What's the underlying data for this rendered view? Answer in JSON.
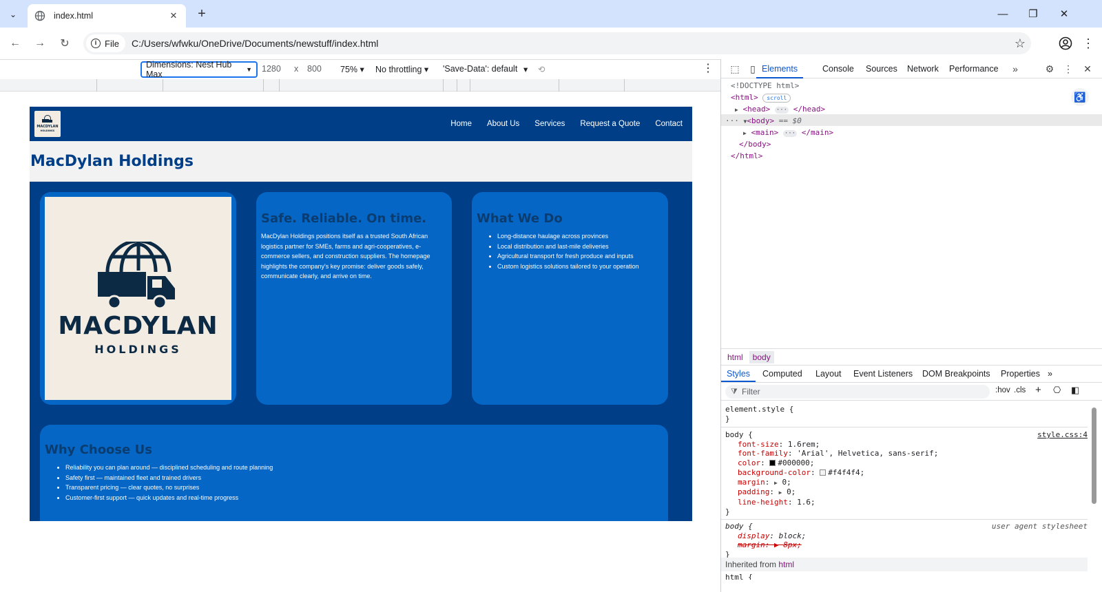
{
  "browser": {
    "tab_title": "index.html",
    "url_chip": "File",
    "url": "C:/Users/wfwku/OneDrive/Documents/newstuff/index.html"
  },
  "device_toolbar": {
    "dimensions_label": "Dimensions: Nest Hub Max",
    "width": "1280",
    "times": "x",
    "height": "800",
    "zoom": "75%",
    "throttling": "No throttling",
    "save_data": "'Save-Data': default"
  },
  "site": {
    "nav": [
      "Home",
      "About Us",
      "Services",
      "Request a Quote",
      "Contact"
    ],
    "logo_small_line1": "MACDYLAN",
    "logo_small_line2": "HOLDINGS",
    "heading": "MacDylan Holdings",
    "logo_main": "MACDYLAN",
    "logo_sub": "HOLDINGS",
    "card_safe_title": "Safe. Reliable. On time.",
    "card_safe_text": "MacDylan Holdings positions itself as a trusted South African logistics partner for SMEs, farms and agri-cooperatives, e-commerce sellers, and construction suppliers. The homepage highlights the company's key promise: deliver goods safely, communicate clearly, and arrive on time.",
    "card_what_title": "What We Do",
    "card_what_items": [
      "Long-distance haulage across provinces",
      "Local distribution and last-mile deliveries",
      "Agricultural transport for fresh produce and inputs",
      "Custom logistics solutions tailored to your operation"
    ],
    "card_why_title": "Why Choose Us",
    "card_why_items": [
      "Reliability you can plan around — disciplined scheduling and route planning",
      "Safety first — maintained fleet and trained drivers",
      "Transparent pricing — clear quotes, no surprises",
      "Customer-first support — quick updates and real-time progress"
    ]
  },
  "devtools": {
    "tabs": [
      "Elements",
      "Console",
      "Sources",
      "Network",
      "Performance"
    ],
    "dom": {
      "doctype": "<!DOCTYPE html>",
      "html_open": "<html>",
      "scroll_pill": "scroll",
      "head": "<head>",
      "head_close": "</head>",
      "body_open": "<body>",
      "body_marker": "== $0",
      "main_open": "<main>",
      "main_close": "</main>",
      "body_close": "</body>",
      "html_close": "</html>"
    },
    "breadcrumbs": [
      "html",
      "body"
    ],
    "subtabs": [
      "Styles",
      "Computed",
      "Layout",
      "Event Listeners",
      "DOM Breakpoints",
      "Properties"
    ],
    "filter_placeholder": "Filter",
    "hov": ":hov",
    "cls": ".cls",
    "styles": {
      "element_style": "element.style {",
      "close_brace": "}",
      "body_selector": "body {",
      "body_source": "style.css:4",
      "body_props": [
        {
          "name": "font-size",
          "value": "1.6rem;"
        },
        {
          "name": "font-family",
          "value": "'Arial', Helvetica, sans-serif;"
        },
        {
          "name": "color",
          "value": "#000000;"
        },
        {
          "name": "background-color",
          "value": "#f4f4f4;"
        },
        {
          "name": "margin",
          "value": "0;"
        },
        {
          "name": "padding",
          "value": "0;"
        },
        {
          "name": "line-height",
          "value": "1.6;"
        }
      ],
      "ua_selector": "body {",
      "ua_source": "user agent stylesheet",
      "ua_props": [
        {
          "name": "display",
          "value": "block;"
        },
        {
          "name": "margin",
          "value": "8px;"
        }
      ],
      "inherited_label": "Inherited from",
      "inherited_tag": "html",
      "next_selector": "html {"
    }
  },
  "colors": {
    "site_nav": "#003f87",
    "card": "#0566c5",
    "heading": "#003f87",
    "accent": "#0b57d0"
  }
}
